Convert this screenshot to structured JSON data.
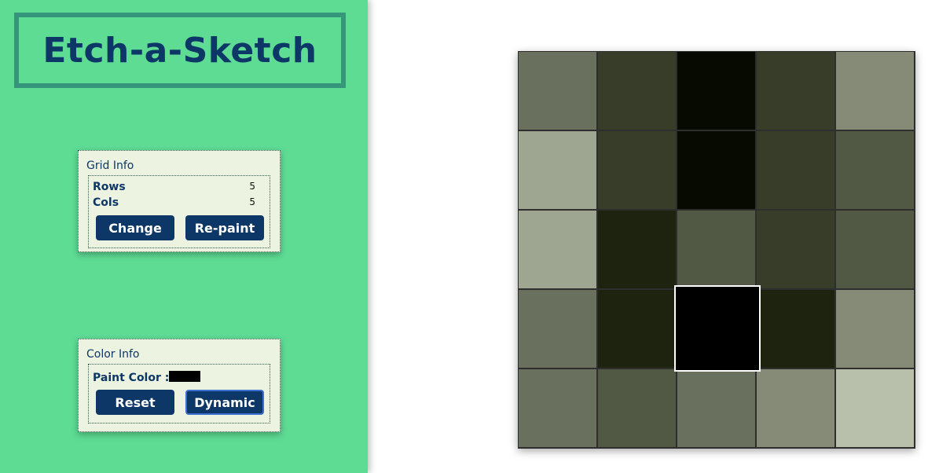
{
  "app": {
    "title": "Etch-a-Sketch"
  },
  "grid_info": {
    "title": "Grid Info",
    "rows_label": "Rows",
    "rows_value": "5",
    "cols_label": "Cols",
    "cols_value": "5",
    "change_label": "Change",
    "repaint_label": "Re-paint"
  },
  "color_info": {
    "title": "Color Info",
    "paint_color_label": "Paint Color :",
    "paint_color": "#000000",
    "reset_label": "Reset",
    "dynamic_label": "Dynamic"
  },
  "colors": {
    "sidebar_bg": "#5edc94",
    "title_border": "#35967c",
    "accent": "#0d3766",
    "panel_bg": "#edf3e1"
  },
  "grid": {
    "rows": 5,
    "cols": 5,
    "hover_cell": [
      3,
      2
    ],
    "cells": [
      [
        "#69705d",
        "#373d29",
        "#060a01",
        "#373d29",
        "#858b77"
      ],
      [
        "#9ea691",
        "#373d29",
        "#060a01",
        "#373d29",
        "#515843"
      ],
      [
        "#9ea691",
        "#1d230f",
        "#515843",
        "#373d29",
        "#515843"
      ],
      [
        "#69705d",
        "#1d230f",
        "#000000",
        "#1d230f",
        "#858b77"
      ],
      [
        "#69705d",
        "#515843",
        "#69705d",
        "#858b77",
        "#b8c0ab"
      ]
    ]
  }
}
